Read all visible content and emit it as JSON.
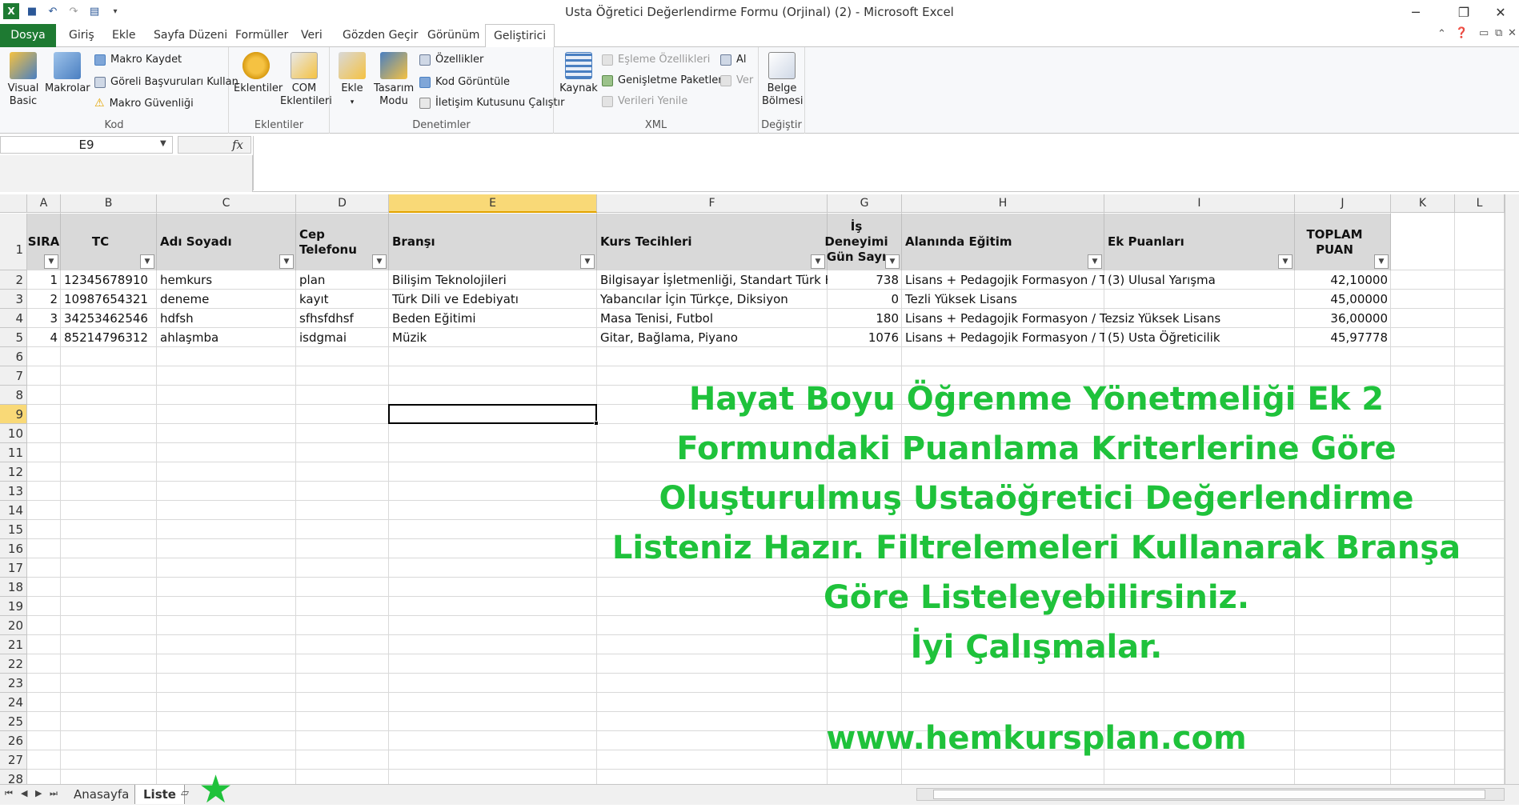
{
  "window": {
    "title": "Usta Öğretici Değerlendirme Formu (Orjinal) (2)  -  Microsoft Excel",
    "minimize": "─",
    "restore": "❐",
    "close": "✕"
  },
  "ribbon_tabs": [
    "Dosya",
    "Giriş",
    "Ekle",
    "Sayfa Düzeni",
    "Formüller",
    "Veri",
    "Gözden Geçir",
    "Görünüm",
    "Geliştirici"
  ],
  "ribbon": {
    "kod": {
      "label": "Kod",
      "visual_basic": "Visual Basic",
      "makrolar": "Makrolar",
      "makro_kaydet": "Makro Kaydet",
      "goreli": "Göreli Başvuruları Kullan",
      "guvenlik": "Makro Güvenliği"
    },
    "eklentiler": {
      "label": "Eklentiler",
      "eklentiler": "Eklentiler",
      "com": "COM Eklentileri"
    },
    "denetimler": {
      "label": "Denetimler",
      "ekle": "Ekle",
      "tasarim": "Tasarım Modu",
      "ozellikler": "Özellikler",
      "kod_goruntule": "Kod Görüntüle",
      "iletisim": "İletişim Kutusunu Çalıştır"
    },
    "xml": {
      "label": "XML",
      "kaynak": "Kaynak",
      "esleme": "Eşleme Özellikleri",
      "genisletme": "Genişletme Paketleri",
      "yenile": "Verileri Yenile",
      "al": "Al",
      "ver": "Ver"
    },
    "degistir": {
      "label": "Değiştir",
      "belge": "Belge Bölmesi"
    }
  },
  "formula_bar": {
    "name_box": "E9",
    "fx": "fx",
    "value": ""
  },
  "columns": [
    "A",
    "B",
    "C",
    "D",
    "E",
    "F",
    "G",
    "H",
    "I",
    "J",
    "K",
    "L"
  ],
  "table_headers": [
    "SIRA",
    "TC",
    "Adı Soyadı",
    "Cep Telefonu",
    "Branşı",
    "Kurs Tecihleri",
    "İş Deneyimi Gün Sayı",
    "Alanında Eğitim",
    "Ek Puanları",
    "TOPLAM PUAN"
  ],
  "rows": [
    [
      "1",
      "12345678910",
      "hemkurs",
      "plan",
      "Bilişim Teknolojileri",
      "Bilgisayar İşletmenliği, Standart Türk Kla",
      "738",
      "Lisans + Pedagojik Formasyon / Te",
      "(3) Ulusal Yarışma",
      "42,10000"
    ],
    [
      "2",
      "10987654321",
      "deneme",
      "kayıt",
      "Türk Dili ve Edebiyatı",
      "Yabancılar İçin Türkçe, Diksiyon",
      "0",
      "Tezli Yüksek Lisans",
      "",
      "45,00000"
    ],
    [
      "3",
      "34253462546",
      "hdfsh",
      "sfhsfdhsf",
      "Beden Eğitimi",
      "Masa Tenisi, Futbol",
      "180",
      "Lisans + Pedagojik Formasyon / Tezsiz Yüksek Lisans",
      "",
      "36,00000"
    ],
    [
      "4",
      "85214796312",
      "ahlaşmba",
      "isdgmai",
      "Müzik",
      "Gitar, Bağlama, Piyano",
      "1076",
      "Lisans + Pedagojik Formasyon / Te",
      "(5) Usta Öğreticilik",
      "45,97778"
    ]
  ],
  "row_numbers": [
    "1",
    "2",
    "3",
    "4",
    "5",
    "6",
    "7",
    "8",
    "9",
    "10",
    "11",
    "12",
    "13",
    "14",
    "15",
    "16",
    "17",
    "18",
    "19",
    "20",
    "21",
    "22",
    "23",
    "24",
    "25",
    "26",
    "27",
    "28"
  ],
  "message": [
    "Hayat Boyu Öğrenme Yönetmeliği Ek 2",
    "Formundaki Puanlama Kriterlerine Göre",
    "Oluşturulmuş Ustaöğretici Değerlendirme",
    "Listeniz Hazır. Filtrelemeleri Kullanarak Branşa",
    "Göre Listeleyebilirsiniz.",
    "İyi Çalışmalar."
  ],
  "website": "www.hemkursplan.com",
  "sheets": [
    "Anasayfa",
    "Liste"
  ],
  "colors": {
    "file_tab": "#1e7a32",
    "message": "#1fc23b",
    "header_fill": "#d9d9d9",
    "selected_header": "#f9d977"
  }
}
